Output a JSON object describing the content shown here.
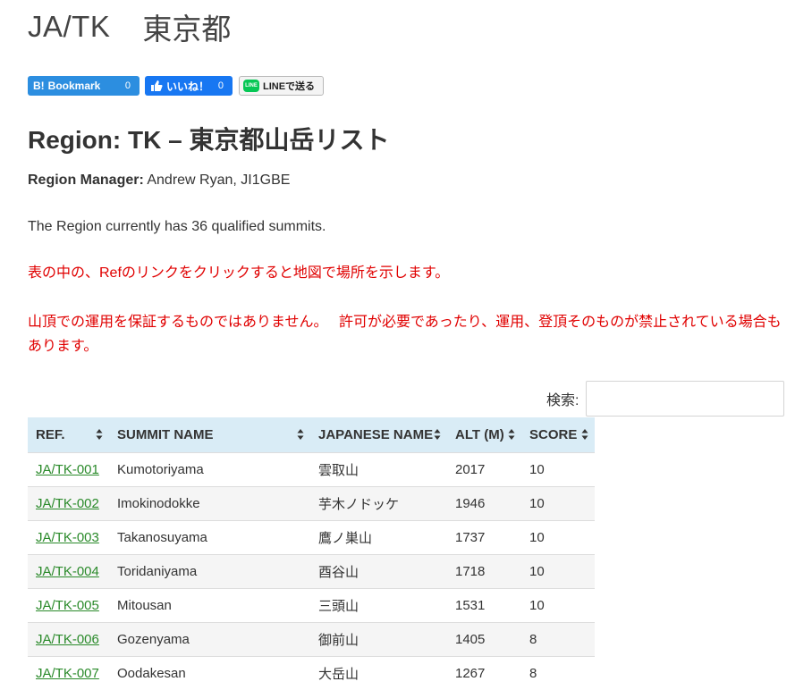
{
  "header": {
    "code": "JA/TK",
    "name": "東京都"
  },
  "share": {
    "hatena": {
      "label": "Bookmark",
      "b_glyph": "B!",
      "count": "0"
    },
    "facebook": {
      "label": "いいね！",
      "count": "0"
    },
    "line": {
      "badge": "LINE",
      "label": "LINEで送る"
    }
  },
  "region": {
    "title": "Region: TK – 東京都山岳リスト",
    "manager_label": "Region Manager:",
    "manager_value": " Andrew Ryan, JI1GBE",
    "qualified_text": "The Region currently has 36 qualified summits.",
    "note_map": "表の中の、Refのリンクをクリックすると地図で場所を示します。",
    "note_warning": "山頂での運用を保証するものではありません。　 許可が必要であったり、運用、登頂そのものが禁止されている場合もあります。"
  },
  "search": {
    "label": "検索:",
    "value": "",
    "placeholder": ""
  },
  "table": {
    "columns": [
      "REF.",
      "SUMMIT NAME",
      "JAPANESE NAME",
      "ALT (M)",
      "SCORE"
    ],
    "rows": [
      {
        "ref": "JA/TK-001",
        "summit": "Kumotoriyama",
        "japanese": "雲取山",
        "alt": "2017",
        "score": "10"
      },
      {
        "ref": "JA/TK-002",
        "summit": "Imokinodokke",
        "japanese": "芋木ノドッケ",
        "alt": "1946",
        "score": "10"
      },
      {
        "ref": "JA/TK-003",
        "summit": "Takanosuyama",
        "japanese": "鷹ノ巣山",
        "alt": "1737",
        "score": "10"
      },
      {
        "ref": "JA/TK-004",
        "summit": "Toridaniyama",
        "japanese": "酉谷山",
        "alt": "1718",
        "score": "10"
      },
      {
        "ref": "JA/TK-005",
        "summit": "Mitousan",
        "japanese": "三頭山",
        "alt": "1531",
        "score": "10"
      },
      {
        "ref": "JA/TK-006",
        "summit": "Gozenyama",
        "japanese": "御前山",
        "alt": "1405",
        "score": "8"
      },
      {
        "ref": "JA/TK-007",
        "summit": "Oodakesan",
        "japanese": "大岳山",
        "alt": "1267",
        "score": "8"
      }
    ]
  },
  "colors": {
    "link": "#2a8a2a",
    "warning_text": "#e00000",
    "table_header_bg": "#d9ecf6",
    "hatena_blue": "#2c8ee0",
    "facebook_blue": "#1877f2",
    "line_green": "#06c755"
  }
}
